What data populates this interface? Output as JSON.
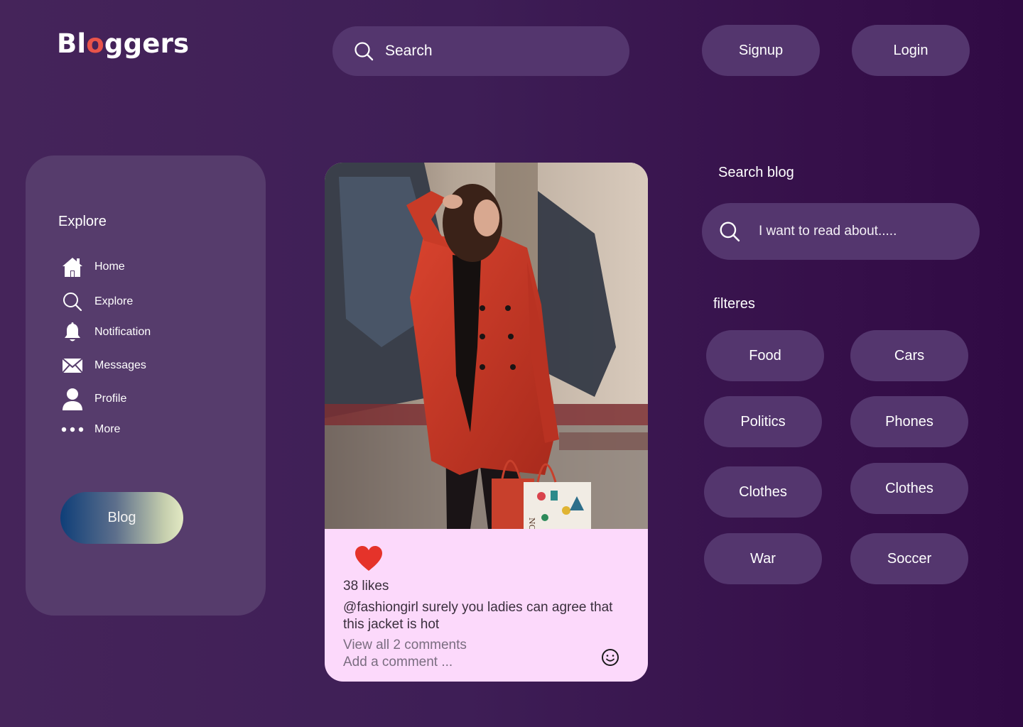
{
  "header": {
    "logo_pre": "Bl",
    "logo_o": "o",
    "logo_post": "ggers",
    "search_label": "Search",
    "signup_label": "Signup",
    "login_label": "Login"
  },
  "sidebar": {
    "title": "Explore",
    "items": [
      {
        "label": "Home",
        "icon": "home-icon"
      },
      {
        "label": "Explore",
        "icon": "search-icon"
      },
      {
        "label": "Notification",
        "icon": "bell-icon"
      },
      {
        "label": "Messages",
        "icon": "mail-icon"
      },
      {
        "label": "Profile",
        "icon": "user-icon"
      },
      {
        "label": "More",
        "icon": "more-icon"
      }
    ],
    "blog_button": "Blog"
  },
  "post": {
    "likes": "38 likes",
    "caption": "@fashiongirl surely you ladies can agree that this jacket is hot",
    "view_comments": "View all 2 comments",
    "add_comment": "Add a comment ...",
    "shopping_bag_text": "NORDS"
  },
  "right_panel": {
    "search_label": "Search blog",
    "search_placeholder": "I want to read about.....",
    "filters_label": "filteres",
    "filters": [
      "Food",
      "Cars",
      "Politics",
      "Phones",
      "Clothes",
      "Clothes",
      "War",
      "Soccer"
    ]
  },
  "colors": {
    "accent_o": "#e8544a",
    "pill_bg": "#54366e",
    "card_bg": "#fcd9fb",
    "heart": "#e5332a"
  }
}
